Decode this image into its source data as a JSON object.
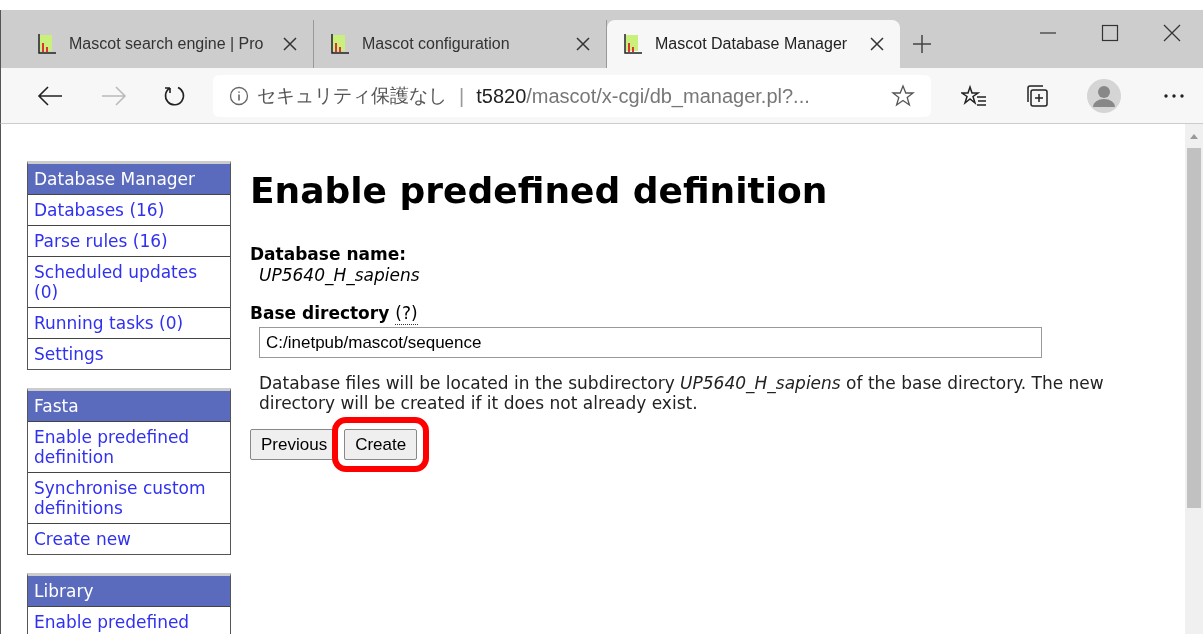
{
  "browser": {
    "tabs": [
      {
        "title": "Mascot search engine | Pro",
        "selected": false
      },
      {
        "title": "Mascot configuration",
        "selected": false
      },
      {
        "title": "Mascot Database Manager",
        "selected": true
      }
    ],
    "address": {
      "security": "セキュリティ保護なし",
      "separator": "|",
      "host": "t5820",
      "path": "/mascot/x-cgi/db_manager.pl?..."
    }
  },
  "sidebar": [
    {
      "title": "Database Manager",
      "items": [
        "Databases (16)",
        "Parse rules (16)",
        "Scheduled updates (0)",
        "Running tasks (0)",
        "Settings"
      ]
    },
    {
      "title": "Fasta",
      "items": [
        "Enable predefined definition",
        "Synchronise custom definitions",
        "Create new"
      ]
    },
    {
      "title": "Library",
      "items": [
        "Enable predefined"
      ]
    }
  ],
  "page": {
    "title": "Enable predefined definition",
    "name_label": "Database name:",
    "name_value": "UP5640_H_sapiens",
    "dir_label": "Base directory",
    "help": "(?)",
    "dir_value": "C:/inetpub/mascot/sequence",
    "note": "Database files will be located in the subdirectory *UP5640_H_sapiens* of the base directory. The new directory will be created if it does not already exist.",
    "buttons": [
      {
        "label": "Previous",
        "highlighted": false
      },
      {
        "label": "Create",
        "highlighted": true
      }
    ]
  }
}
